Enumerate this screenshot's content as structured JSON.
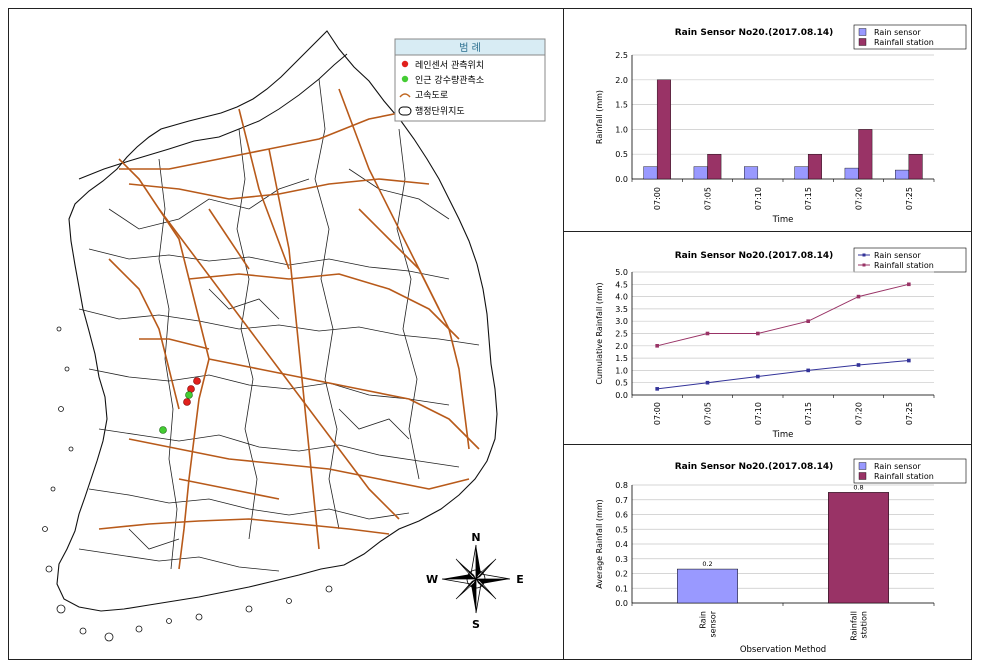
{
  "map": {
    "legend": {
      "title": "범      례",
      "items": [
        {
          "label": "레인센서 관측위치",
          "kind": "dot",
          "color": "#e0201c"
        },
        {
          "label": "인근 강수량관측소",
          "kind": "dot",
          "color": "#44cc33"
        },
        {
          "label": "고속도로",
          "kind": "line",
          "color": "#c0661f"
        },
        {
          "label": "행정단위지도",
          "kind": "ellipse",
          "color": "#000000"
        }
      ]
    },
    "compass": {
      "n": "N",
      "s": "S",
      "e": "E",
      "w": "W"
    },
    "colors": {
      "road": "#b85a1a",
      "boundary": "#111111"
    }
  },
  "chart_data": [
    {
      "type": "bar",
      "title": "Rain Sensor No20.(2017.08.14)",
      "xlabel": "Time",
      "ylabel": "Rainfall (mm)",
      "ylim": [
        0,
        2.5
      ],
      "yticks": [
        "0.0",
        "0.5",
        "1.0",
        "1.5",
        "2.0",
        "2.5"
      ],
      "yticks_values": [
        0,
        0.5,
        1.0,
        1.5,
        2.0,
        2.5
      ],
      "categories": [
        "07:00",
        "07:05",
        "07:10",
        "07:15",
        "07:20",
        "07:25"
      ],
      "series": [
        {
          "name": "Rain sensor",
          "color": "#9999ff",
          "values": [
            0.25,
            0.25,
            0.25,
            0.25,
            0.22,
            0.18
          ]
        },
        {
          "name": "Rainfall station",
          "color": "#993366",
          "values": [
            2.0,
            0.5,
            0,
            0.5,
            1.0,
            0.5
          ]
        }
      ],
      "legend": "top-right",
      "grid": true
    },
    {
      "type": "line",
      "title": "Rain Sensor No20.(2017.08.14)",
      "xlabel": "Time",
      "ylabel": "Cumulative Rainfall (mm)",
      "ylim": [
        0,
        5.0
      ],
      "yticks": [
        "0.0",
        "0.5",
        "1.0",
        "1.5",
        "2.0",
        "2.5",
        "3.0",
        "3.5",
        "4.0",
        "4.5",
        "5.0"
      ],
      "yticks_values": [
        0,
        0.5,
        1.0,
        1.5,
        2.0,
        2.5,
        3.0,
        3.5,
        4.0,
        4.5,
        5.0
      ],
      "categories": [
        "07:00",
        "07:05",
        "07:10",
        "07:15",
        "07:20",
        "07:25"
      ],
      "series": [
        {
          "name": "Rain sensor",
          "color": "#333399",
          "values": [
            0.25,
            0.5,
            0.75,
            1.0,
            1.22,
            1.4
          ]
        },
        {
          "name": "Rainfall station",
          "color": "#993366",
          "values": [
            2.0,
            2.5,
            2.5,
            3.0,
            4.0,
            4.5
          ]
        }
      ],
      "legend": "top-right",
      "grid": true
    },
    {
      "type": "bar",
      "title": "Rain Sensor No20.(2017.08.14)",
      "xlabel": "Observation Method",
      "ylabel": "Average Rainfall (mm)",
      "ylim": [
        0,
        0.8
      ],
      "yticks": [
        "0.0",
        "0.1",
        "0.2",
        "0.3",
        "0.4",
        "0.5",
        "0.6",
        "0.7",
        "0.8"
      ],
      "yticks_values": [
        0,
        0.1,
        0.2,
        0.3,
        0.4,
        0.5,
        0.6,
        0.7,
        0.8
      ],
      "categories": [
        "Rain sensor",
        "Rainfall station"
      ],
      "category_lines": [
        [
          "Rain",
          "sensor"
        ],
        [
          "Rainfall",
          "station"
        ]
      ],
      "series": [
        {
          "name": "Rain sensor",
          "color": "#9999ff",
          "values": [
            0.23,
            null
          ]
        },
        {
          "name": "Rainfall station",
          "color": "#993366",
          "values": [
            null,
            0.75
          ]
        }
      ],
      "data_labels": [
        "0.2",
        "0.8"
      ],
      "legend": "top-right",
      "grid": true
    }
  ]
}
